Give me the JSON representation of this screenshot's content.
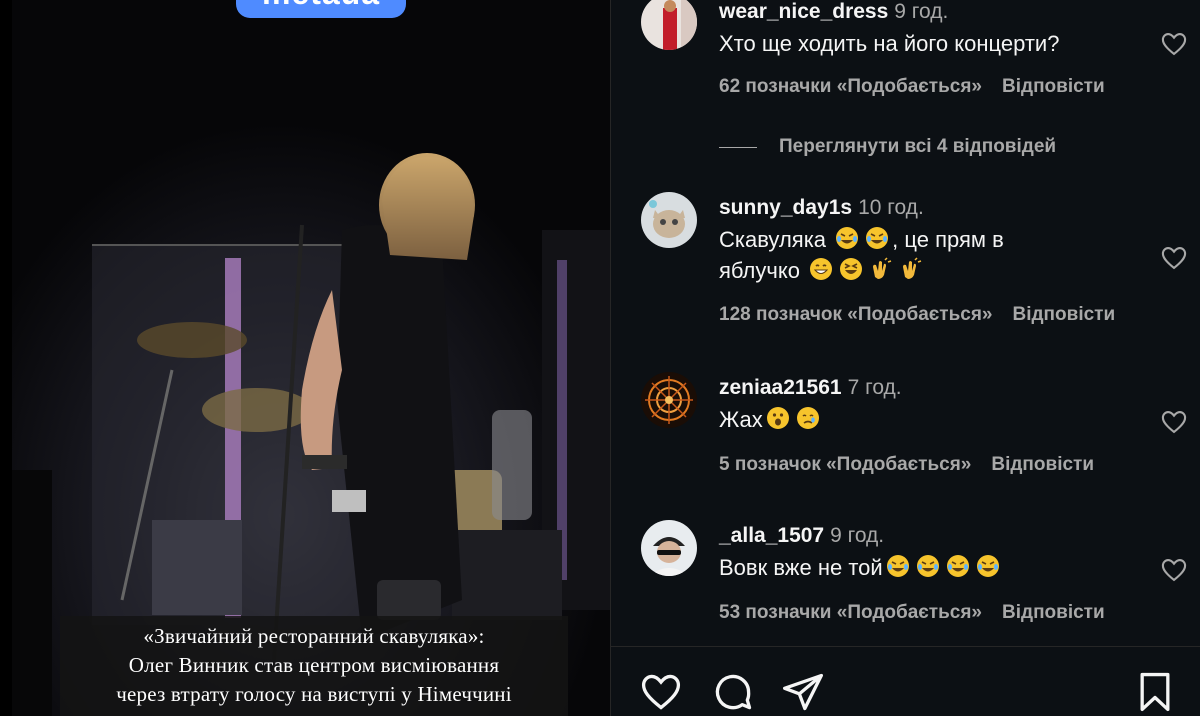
{
  "media": {
    "brand_label": "metaua",
    "caption_lines": [
      "«Звичайний ресторанний скавуляка»:",
      "Олег Винник став центром висміювання",
      "через втрату голосу на виступі у Німеччині"
    ]
  },
  "comments_panel": {
    "view_replies": "Переглянути всі 4 відповідей",
    "reply_label": "Відповісти",
    "comments": [
      {
        "username": "wear_nice_dress",
        "time": "9 год.",
        "text": "Хто ще ходить на його концерти?",
        "likes": "62 позначки «Подобається»"
      },
      {
        "username": "sunny_day1s",
        "time": "10 год.",
        "text_line1": "Скавуляка",
        "text_line1_tail": ", це прям в",
        "text_line2": "яблучко",
        "likes": "128 позначок «Подобається»"
      },
      {
        "username": "zeniaa21561",
        "time": "7 год.",
        "text": "Жах",
        "likes": "5 позначок «Подобається»"
      },
      {
        "username": "_alla_1507",
        "time": "9 год.",
        "text": "Вовк вже не той",
        "likes": "53 позначки «Подобається»"
      }
    ]
  },
  "icons": {
    "heart": "heart-icon",
    "comment": "comment-bubble-icon",
    "share": "paper-plane-icon",
    "save": "bookmark-icon"
  },
  "colors": {
    "background": "#0c1014",
    "secondary_text": "#a8a8a8",
    "brand_pill": "#4f8bff"
  }
}
